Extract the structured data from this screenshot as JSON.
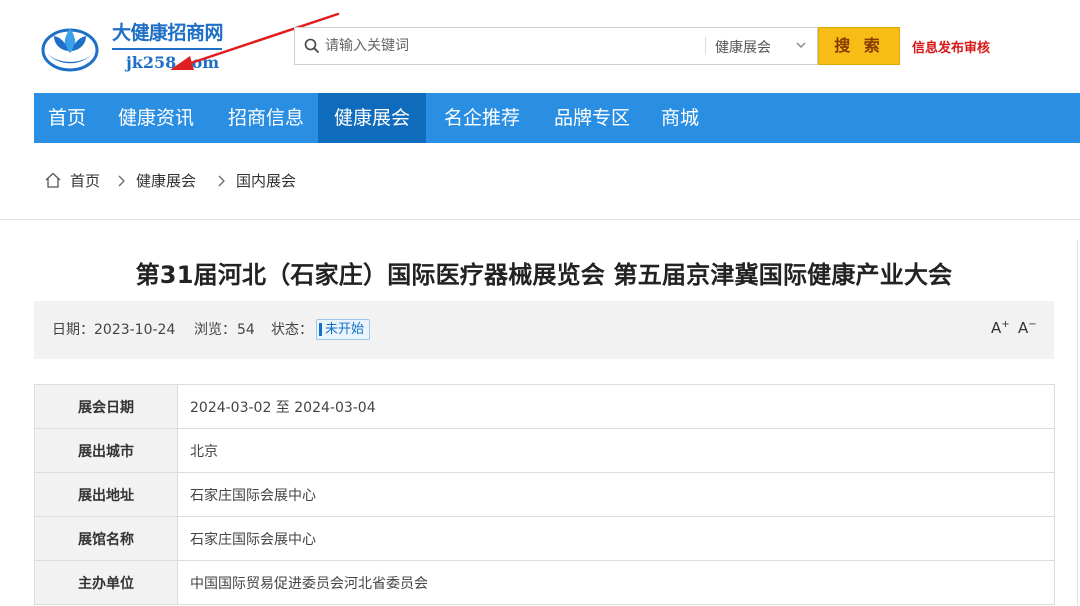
{
  "logo": {
    "title": "大健康招商网",
    "domain": "jk258.com"
  },
  "search": {
    "placeholder": "请输入关键词",
    "category": "健康展会",
    "button": "搜 索",
    "audit_link": "信息发布审核"
  },
  "nav": {
    "items": [
      {
        "label": "首页"
      },
      {
        "label": "健康资讯"
      },
      {
        "label": "招商信息"
      },
      {
        "label": "健康展会",
        "active": true
      },
      {
        "label": "名企推荐"
      },
      {
        "label": "品牌专区"
      },
      {
        "label": "商城"
      }
    ]
  },
  "breadcrumb": {
    "items": [
      "首页",
      "健康展会",
      "国内展会"
    ]
  },
  "article": {
    "title": "第31届河北（石家庄）国际医疗器械展览会 第五届京津冀国际健康产业大会",
    "meta": {
      "date_label": "日期：",
      "date": "2023-10-24",
      "views_label": "浏览：",
      "views": "54",
      "status_label": "状态：",
      "status": "未开始"
    },
    "font_controls": {
      "increase": "A",
      "decrease": "A"
    }
  },
  "info": {
    "rows": [
      {
        "label": "展会日期",
        "value": "2024-03-02 至 2024-03-04"
      },
      {
        "label": "展出城市",
        "value": "北京"
      },
      {
        "label": "展出地址",
        "value": "石家庄国际会展中心"
      },
      {
        "label": "展馆名称",
        "value": "石家庄国际会展中心"
      },
      {
        "label": "主办单位",
        "value": "中国国际贸易促进委员会河北省委员会"
      }
    ]
  },
  "colors": {
    "nav_bg": "#2a8fe3",
    "nav_active": "#0f6cbd",
    "brand_blue": "#1e6fc6",
    "search_button": "#f7bd16",
    "audit_red": "#d71818",
    "arrow_red": "#e02020"
  },
  "icons": {
    "logo": "leaf-water-drop-logo",
    "search": "search-icon",
    "dropdown": "chevron-down-icon",
    "home": "home-icon",
    "separator": "chevron-right-icon",
    "annotation": "red-arrow-annotation"
  }
}
